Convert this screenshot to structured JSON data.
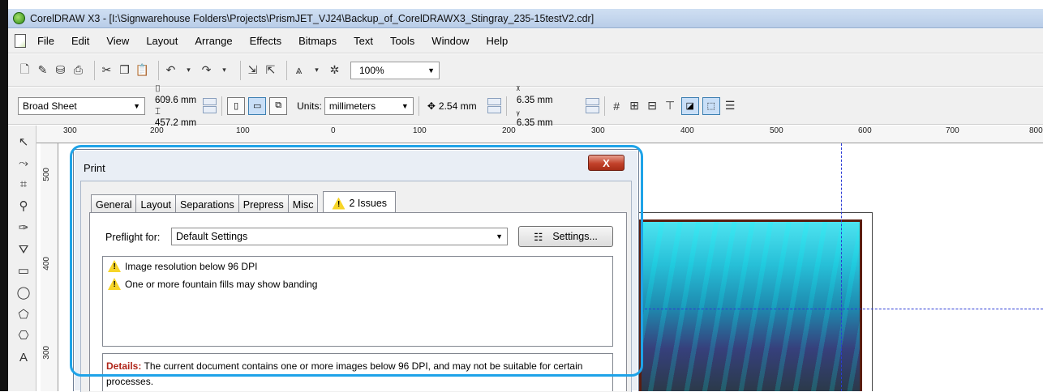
{
  "window": {
    "title": "CorelDRAW X3 - [I:\\Signwarehouse Folders\\Projects\\PrismJET_VJ24\\Backup_of_CorelDRAWX3_Stingray_235-15testV2.cdr]"
  },
  "menubar": {
    "items": [
      "File",
      "Edit",
      "View",
      "Layout",
      "Arrange",
      "Effects",
      "Bitmaps",
      "Text",
      "Tools",
      "Window",
      "Help"
    ]
  },
  "toolbar": {
    "zoom": "100%"
  },
  "property_bar": {
    "paper_type": "Broad Sheet",
    "width": "609.6 mm",
    "height": "457.2 mm",
    "units_label": "Units:",
    "units_value": "millimeters",
    "nudge": "2.54 mm",
    "dup_x": "6.35 mm",
    "dup_y": "6.35 mm"
  },
  "ruler": {
    "top_labels": [
      "300",
      "200",
      "100",
      "0",
      "100",
      "200",
      "300",
      "400",
      "500",
      "600",
      "700",
      "800"
    ],
    "left_labels": [
      "500",
      "400",
      "300"
    ]
  },
  "dialog": {
    "title": "Print",
    "close_label": "X",
    "tabs": [
      "General",
      "Layout",
      "Separations",
      "Prepress",
      "Misc",
      "2 Issues"
    ],
    "preflight_label": "Preflight for:",
    "preflight_value": "Default Settings",
    "settings_label": "Settings...",
    "issues": [
      "Image resolution below 96 DPI",
      "One or more fountain fills may show banding"
    ],
    "details_label": "Details:",
    "details_text": "The current document contains one or more images below 96 DPI, and may not be suitable for certain processes."
  }
}
